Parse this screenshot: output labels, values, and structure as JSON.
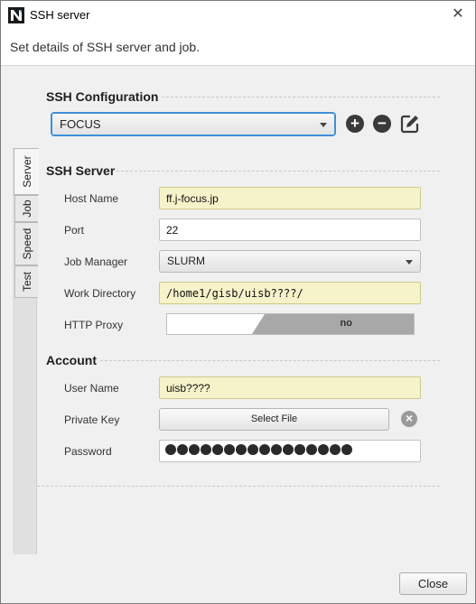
{
  "window": {
    "title": "SSH server",
    "header": "Set details of SSH server and job."
  },
  "ssh_config": {
    "section_title": "SSH Configuration",
    "selected": "FOCUS",
    "icons": [
      "add-icon",
      "remove-icon",
      "edit-icon"
    ]
  },
  "tabs": [
    {
      "label": "Server",
      "active": true
    },
    {
      "label": "Job",
      "active": false
    },
    {
      "label": "Speed",
      "active": false
    },
    {
      "label": "Test",
      "active": false
    }
  ],
  "ssh_server": {
    "section_title": "SSH Server",
    "host_name_label": "Host Name",
    "host_name": "ff.j-focus.jp",
    "port_label": "Port",
    "port": "22",
    "job_manager_label": "Job Manager",
    "job_manager": "SLURM",
    "work_dir_label": "Work Directory",
    "work_dir": "/home1/gisb/uisb????/",
    "http_proxy_label": "HTTP Proxy",
    "http_proxy": "no"
  },
  "account": {
    "section_title": "Account",
    "user_name_label": "User Name",
    "user_name": "uisb????",
    "private_key_label": "Private Key",
    "select_file": "Select File",
    "password_label": "Password",
    "password_mask_count": 16
  },
  "footer": {
    "close": "Close"
  },
  "colors": {
    "required_field": "#f6f2c9",
    "focus_ring": "#3d8fd9",
    "toggle_off": "#a8a8a8"
  }
}
